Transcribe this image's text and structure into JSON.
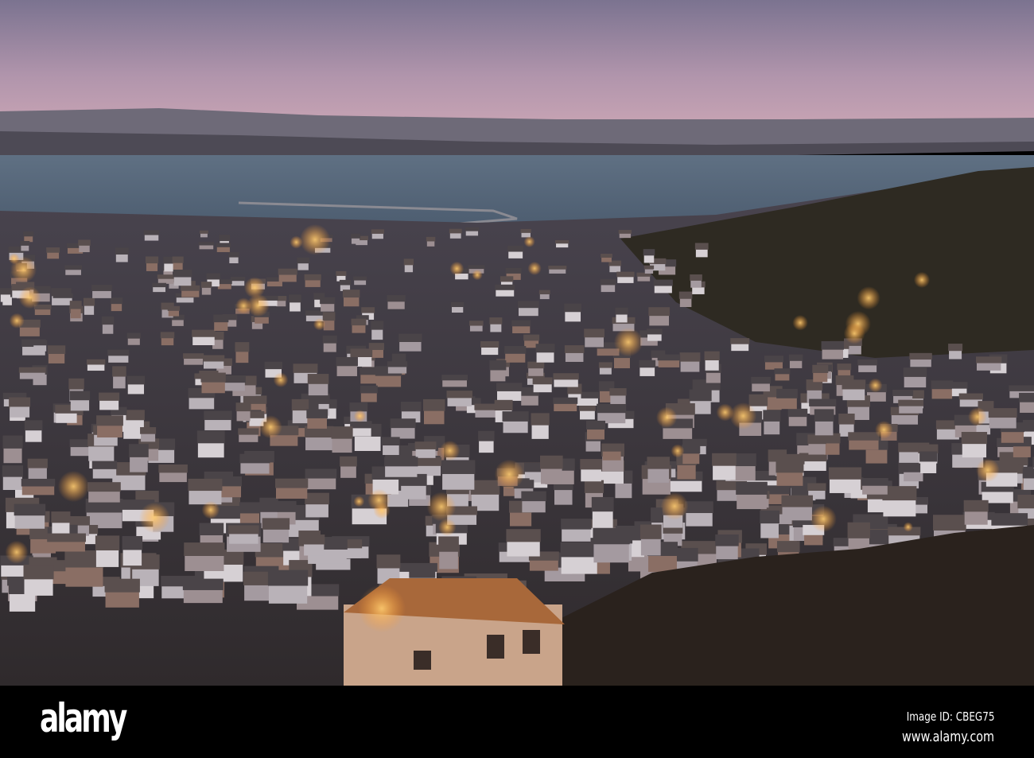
{
  "photo": {
    "subject": "Dusk view over a hillside town, harbour and bay",
    "colors": {
      "sky_top": "#7d7590",
      "sky_bottom": "#c9a3b3",
      "water": "#5b6d80",
      "roof": "#4a4448",
      "light": "#ffb24a"
    }
  },
  "footer": {
    "logo": "alamy",
    "image_id": "Image ID: CBEG75",
    "url": "www.alamy.com"
  }
}
